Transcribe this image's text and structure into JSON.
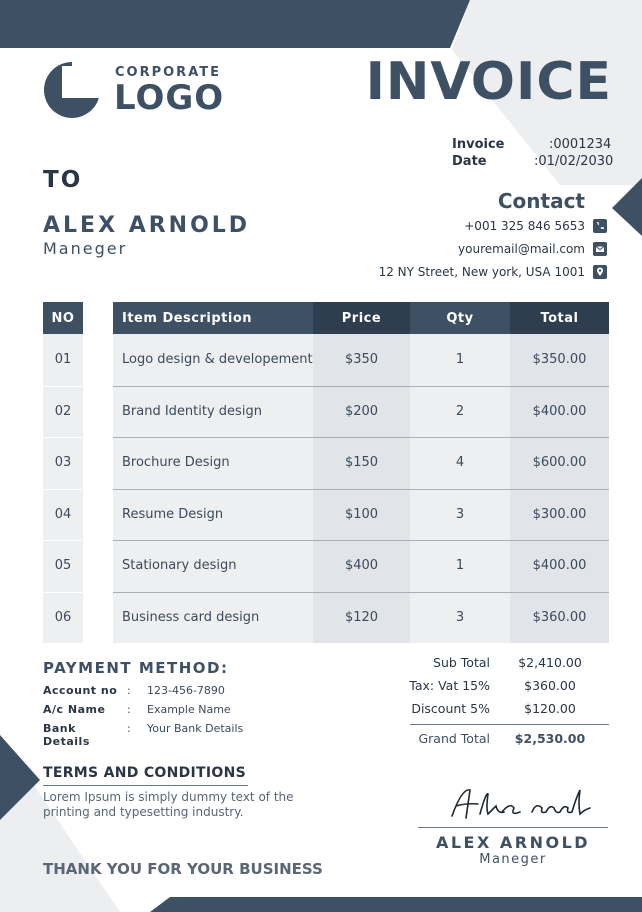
{
  "brand": {
    "logo_small": "CORPORATE",
    "logo_big": "LOGO",
    "colors": {
      "primary": "#3e5064",
      "dark": "#2f3e4f",
      "light_gray": "#eeeff0"
    }
  },
  "invoice": {
    "title": "INVOICE",
    "number_label": "Invoice",
    "number_value": ":0001234",
    "date_label": "Date",
    "date_value": ":01/02/2030"
  },
  "to": {
    "label": "TO",
    "name": "ALEX ARNOLD",
    "role": "Maneger"
  },
  "contact": {
    "title": "Contact",
    "phone": "+001 325 846 5653",
    "email": "youremail@mail.com",
    "address": "12 NY Street, New york, USA 1001",
    "icons": [
      "phone-icon",
      "mail-icon",
      "location-pin-icon"
    ]
  },
  "table": {
    "headers": {
      "no": "NO",
      "description": "Item Description",
      "price": "Price",
      "qty": "Qty",
      "total": "Total"
    },
    "rows": [
      {
        "no": "01",
        "description": "Logo design & developement",
        "price": "$350",
        "qty": "1",
        "total": "$350.00"
      },
      {
        "no": "02",
        "description": "Brand Identity design",
        "price": "$200",
        "qty": "2",
        "total": "$400.00"
      },
      {
        "no": "03",
        "description": "Brochure Design",
        "price": "$150",
        "qty": "4",
        "total": "$600.00"
      },
      {
        "no": "04",
        "description": "Resume Design",
        "price": "$100",
        "qty": "3",
        "total": "$300.00"
      },
      {
        "no": "05",
        "description": "Stationary design",
        "price": "$400",
        "qty": "1",
        "total": "$400.00"
      },
      {
        "no": "06",
        "description": "Business card design",
        "price": "$120",
        "qty": "3",
        "total": "$360.00"
      }
    ]
  },
  "payment": {
    "title": "PAYMENT METHOD:",
    "rows": [
      {
        "label": "Account no",
        "sep": ":",
        "value": "123-456-7890"
      },
      {
        "label": "A/c Name",
        "sep": ":",
        "value": "Example Name"
      },
      {
        "label": "Bank Details",
        "sep": ":",
        "value": "Your Bank Details"
      }
    ]
  },
  "totals": {
    "subtotal_label": "Sub Total",
    "subtotal_value": "$2,410.00",
    "tax_label": "Tax: Vat 15%",
    "tax_value": "$360.00",
    "discount_label": "Discount 5%",
    "discount_value": "$120.00",
    "grand_label": "Grand Total",
    "grand_value": "$2,530.00"
  },
  "terms": {
    "title": "TERMS AND CONDITIONS",
    "text": "Lorem Ipsum is simply dummy text of the printing and typesetting industry."
  },
  "signature": {
    "script": "Alex arnold",
    "name": "ALEX ARNOLD",
    "role": "Maneger"
  },
  "footer": {
    "thanks": "THANK YOU FOR YOUR BUSINESS"
  }
}
